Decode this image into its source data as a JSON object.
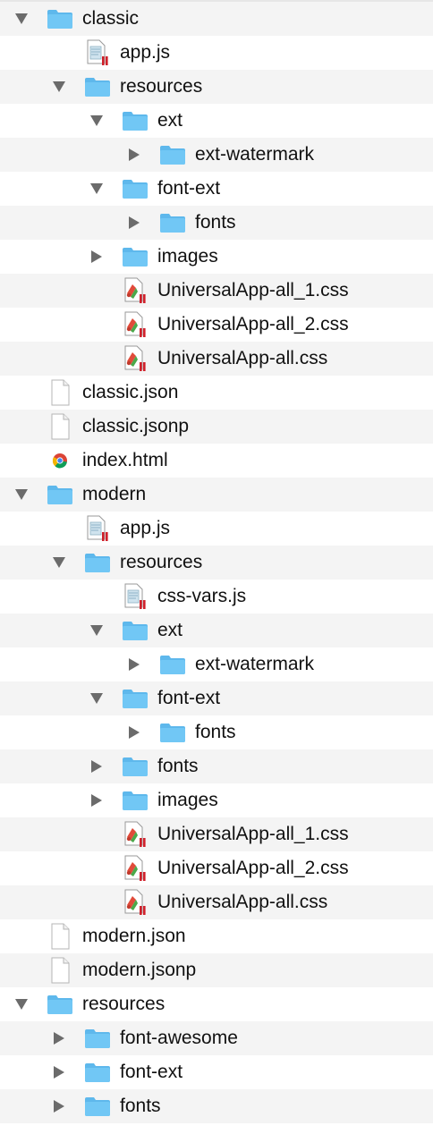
{
  "colors": {
    "folder": "#71c7f5",
    "folder_tab": "#5eb8ec",
    "disclosure": "#6b6b6b",
    "stripe": "#f4f4f4"
  },
  "rows": [
    {
      "label": "classic",
      "level": 0,
      "kind": "folder",
      "disclosure": "open"
    },
    {
      "label": "app.js",
      "level": 1,
      "kind": "script"
    },
    {
      "label": "resources",
      "level": 1,
      "kind": "folder",
      "disclosure": "open"
    },
    {
      "label": "ext",
      "level": 2,
      "kind": "folder",
      "disclosure": "open"
    },
    {
      "label": "ext-watermark",
      "level": 3,
      "kind": "folder",
      "disclosure": "closed"
    },
    {
      "label": "font-ext",
      "level": 2,
      "kind": "folder",
      "disclosure": "open"
    },
    {
      "label": "fonts",
      "level": 3,
      "kind": "folder",
      "disclosure": "closed"
    },
    {
      "label": "images",
      "level": 2,
      "kind": "folder",
      "disclosure": "closed"
    },
    {
      "label": "UniversalApp-all_1.css",
      "level": 2,
      "kind": "css"
    },
    {
      "label": "UniversalApp-all_2.css",
      "level": 2,
      "kind": "css"
    },
    {
      "label": "UniversalApp-all.css",
      "level": 2,
      "kind": "css"
    },
    {
      "label": "classic.json",
      "level": 0,
      "kind": "file"
    },
    {
      "label": "classic.jsonp",
      "level": 0,
      "kind": "file"
    },
    {
      "label": "index.html",
      "level": 0,
      "kind": "html"
    },
    {
      "label": "modern",
      "level": 0,
      "kind": "folder",
      "disclosure": "open"
    },
    {
      "label": "app.js",
      "level": 1,
      "kind": "script"
    },
    {
      "label": "resources",
      "level": 1,
      "kind": "folder",
      "disclosure": "open"
    },
    {
      "label": "css-vars.js",
      "level": 2,
      "kind": "script"
    },
    {
      "label": "ext",
      "level": 2,
      "kind": "folder",
      "disclosure": "open"
    },
    {
      "label": "ext-watermark",
      "level": 3,
      "kind": "folder",
      "disclosure": "closed"
    },
    {
      "label": "font-ext",
      "level": 2,
      "kind": "folder",
      "disclosure": "open"
    },
    {
      "label": "fonts",
      "level": 3,
      "kind": "folder",
      "disclosure": "closed"
    },
    {
      "label": "fonts",
      "level": 2,
      "kind": "folder",
      "disclosure": "closed"
    },
    {
      "label": "images",
      "level": 2,
      "kind": "folder",
      "disclosure": "closed"
    },
    {
      "label": "UniversalApp-all_1.css",
      "level": 2,
      "kind": "css"
    },
    {
      "label": "UniversalApp-all_2.css",
      "level": 2,
      "kind": "css"
    },
    {
      "label": "UniversalApp-all.css",
      "level": 2,
      "kind": "css"
    },
    {
      "label": "modern.json",
      "level": 0,
      "kind": "file"
    },
    {
      "label": "modern.jsonp",
      "level": 0,
      "kind": "file"
    },
    {
      "label": "resources",
      "level": 0,
      "kind": "folder",
      "disclosure": "open"
    },
    {
      "label": "font-awesome",
      "level": 1,
      "kind": "folder",
      "disclosure": "closed"
    },
    {
      "label": "font-ext",
      "level": 1,
      "kind": "folder",
      "disclosure": "closed"
    },
    {
      "label": "fonts",
      "level": 1,
      "kind": "folder",
      "disclosure": "closed"
    }
  ]
}
